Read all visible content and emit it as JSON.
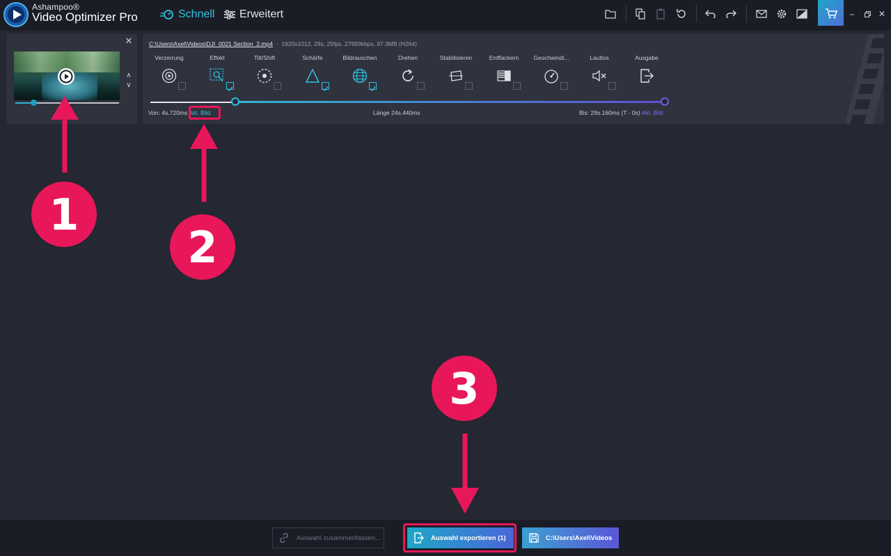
{
  "app": {
    "brand_small": "Ashampoo®",
    "brand_name": "Video Optimizer Pro",
    "modes": [
      {
        "label": "Schnell",
        "active": true
      },
      {
        "label": "Erweitert",
        "active": false
      }
    ]
  },
  "toolbar_icons": [
    "folder-icon",
    "copy-icon",
    "paste-icon",
    "reset-icon",
    "undo-icon",
    "redo-icon",
    "mail-icon",
    "settings-icon",
    "theme-icon",
    "cart-icon"
  ],
  "window_controls": [
    "minimize",
    "restore",
    "close"
  ],
  "clip": {
    "path": "C:\\Users\\Axel\\Videos\\DJI_0021 Section_2.mp4",
    "separator": "-",
    "info": "1920x1012, 29s, 25fps, 27993kbps, 97.3MB (H264)"
  },
  "effects": [
    {
      "label": "Verzerrung",
      "icon": "eye-icon",
      "checked": false
    },
    {
      "label": "Effekt",
      "icon": "effect-icon",
      "checked": true
    },
    {
      "label": "Tilt/Shift",
      "icon": "tilt-shift-icon",
      "checked": false
    },
    {
      "label": "Schärfe",
      "icon": "sharpness-icon",
      "checked": true
    },
    {
      "label": "Bildrauschen",
      "icon": "noise-icon",
      "checked": true
    },
    {
      "label": "Drehen",
      "icon": "rotate-icon",
      "checked": false
    },
    {
      "label": "Stabilisieren",
      "icon": "stabilize-icon",
      "checked": false
    },
    {
      "label": "Entflackern",
      "icon": "deflicker-icon",
      "checked": false
    },
    {
      "label": "Geschwindi...",
      "icon": "speed-icon",
      "checked": false
    },
    {
      "label": "Lautlos",
      "icon": "mute-icon",
      "checked": false
    },
    {
      "label": "Ausgabe",
      "icon": "output-icon",
      "checked": null
    }
  ],
  "trim": {
    "from_label": "Von: 4s.720ms",
    "from_link": "Akt. Bild",
    "length_label": "Länge 24s.440ms",
    "to_label": "Bis: 29s.160ms (T - 0s)",
    "to_link": "Akt. Bild"
  },
  "bottom": {
    "merge_label": "Auswahl zusammenfassen...",
    "export_label": "Auswahl exportieren (1)",
    "folder_label": "C:\\Users\\Axel\\Videos"
  },
  "annotations": [
    "1",
    "2",
    "3"
  ],
  "colors": {
    "accent": "#2fc3e0",
    "highlight": "#e8175a",
    "background": "#252732",
    "panel": "#30323e"
  }
}
